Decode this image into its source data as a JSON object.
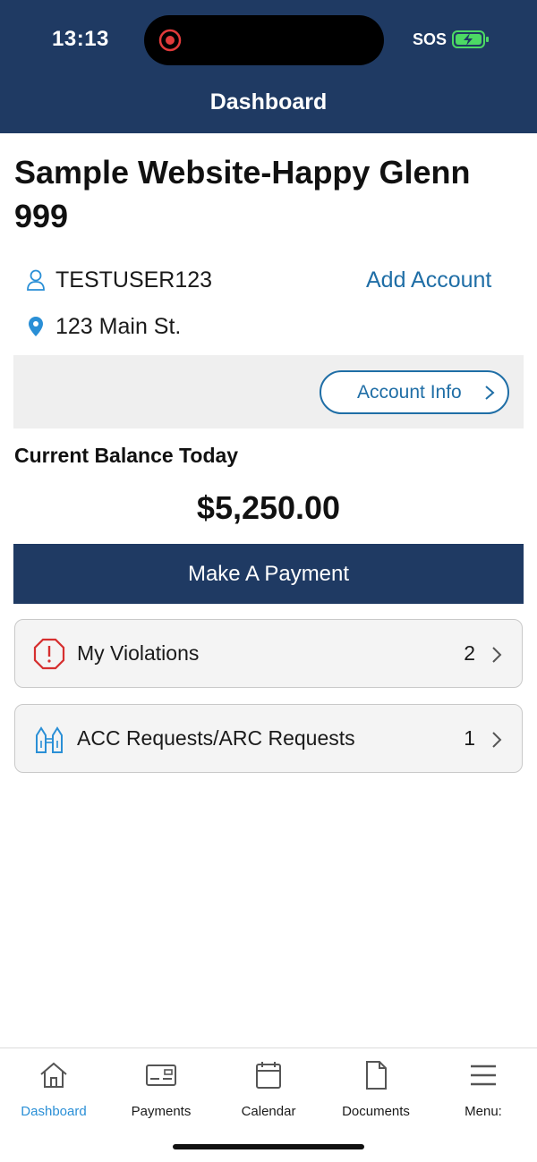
{
  "status_bar": {
    "time": "13:13",
    "carrier": "SOS"
  },
  "header": {
    "title": "Dashboard"
  },
  "account": {
    "name": "Sample Website-Happy Glenn 999",
    "username": "TESTUSER123",
    "address": "123 Main St.",
    "add_account_label": "Add Account",
    "account_info_label": "Account Info"
  },
  "balance": {
    "label": "Current Balance Today",
    "value": "$5,250.00"
  },
  "payment_button": "Make A Payment",
  "cards": [
    {
      "label": "My Violations",
      "count": "2",
      "icon": "violation-octagon-icon"
    },
    {
      "label": "ACC Requests/ARC Requests",
      "count": "1",
      "icon": "architecture-icon"
    }
  ],
  "tabs": [
    {
      "label": "Dashboard",
      "icon": "home-icon",
      "active": true
    },
    {
      "label": "Payments",
      "icon": "card-icon"
    },
    {
      "label": "Calendar",
      "icon": "calendar-icon"
    },
    {
      "label": "Documents",
      "icon": "document-icon"
    },
    {
      "label": "Menu:",
      "icon": "hamburger-icon"
    }
  ],
  "colors": {
    "navy": "#1f3a63",
    "link_blue": "#1f6ea6",
    "active_tab": "#2a8fd6",
    "violation_red": "#d62f2f"
  }
}
